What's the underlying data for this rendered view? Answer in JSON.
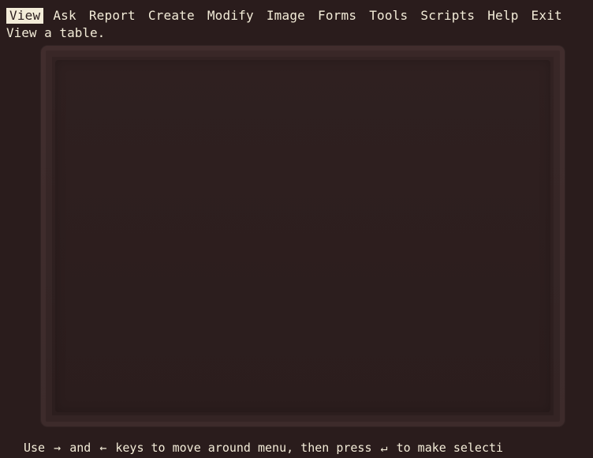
{
  "menu": {
    "items": [
      {
        "label": "View",
        "selected": true
      },
      {
        "label": "Ask",
        "selected": false
      },
      {
        "label": "Report",
        "selected": false
      },
      {
        "label": "Create",
        "selected": false
      },
      {
        "label": "Modify",
        "selected": false
      },
      {
        "label": "Image",
        "selected": false
      },
      {
        "label": "Forms",
        "selected": false
      },
      {
        "label": "Tools",
        "selected": false
      },
      {
        "label": "Scripts",
        "selected": false
      },
      {
        "label": "Help",
        "selected": false
      },
      {
        "label": "Exit",
        "selected": false
      }
    ],
    "description": "View a table."
  },
  "status": {
    "prefix": "Use",
    "right_arrow": "→",
    "and": "and",
    "left_arrow": "←",
    "middle": "keys to move around menu, then press",
    "enter_key": "↵",
    "suffix": "to make selecti"
  }
}
